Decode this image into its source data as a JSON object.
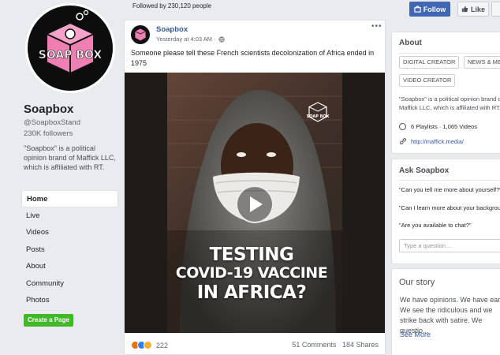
{
  "colors": {
    "page_bg": "#e9ebee",
    "brand_blue": "#4267b2",
    "link": "#385898",
    "create_green": "#42b72a",
    "logo_pink": "#f080b4"
  },
  "page": {
    "name": "Soapbox",
    "handle": "@SoapboxStand",
    "followers": "230K followers",
    "bio": "\"Soapbox\" is a political opinion brand of Maffick LLC, which is affiliated with RT.",
    "logo_text": "SOAP BOX",
    "nav": [
      {
        "label": "Home",
        "active": true
      },
      {
        "label": "Live"
      },
      {
        "label": "Videos"
      },
      {
        "label": "Posts"
      },
      {
        "label": "About"
      },
      {
        "label": "Community"
      },
      {
        "label": "Photos"
      }
    ],
    "create_button": "Create a Page"
  },
  "top": {
    "followed_by": "Followed by 230,120 people",
    "follow_label": "Follow",
    "like_label": "Like"
  },
  "post": {
    "author": "Soapbox",
    "meta": "Yesterday at 4:03 AM · ",
    "more_icon": "ellipsis-icon",
    "text": "Someone please tell these French scientists decolonization of Africa ended in 1975",
    "video_title_line1": "TESTING",
    "video_title_line2": "COVID-19 VACCINE",
    "video_title_line3": "IN AFRICA?",
    "video_logo": "SOAP BOX",
    "reaction_count": "222",
    "comments": "51 Comments",
    "shares": "184 Shares"
  },
  "about": {
    "title": "About",
    "chips": [
      "DIGITAL CREATOR",
      "NEWS & MEDIA",
      "VIDEO CREATOR"
    ],
    "description": "\"Soapbox\" is a political opinion brand of Maffick LLC, which is affiliated with RT.",
    "playlists": "6 Playlists · 1,065 Videos",
    "website": "http://maffick.media/"
  },
  "ask": {
    "title": "Ask Soapbox",
    "questions": [
      "\"Can you tell me more about yourself?\"",
      "\"Can I learn more about your background?\"",
      "\"Are you available to chat?\""
    ],
    "input_placeholder": "Type a question..."
  },
  "story": {
    "title": "Our story",
    "text": "We have opinions. We have ears. We see the ridiculous and we strike back with satire. We questio...",
    "more": "See More"
  }
}
